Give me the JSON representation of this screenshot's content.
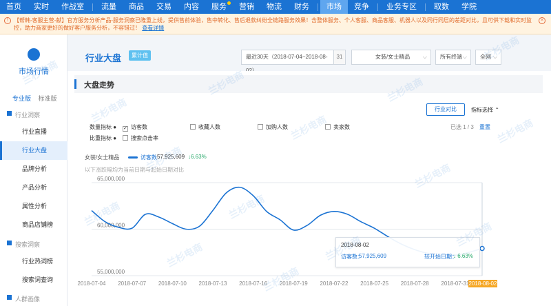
{
  "nav": {
    "items": [
      "首页",
      "实时",
      "作战室",
      "流量",
      "商品",
      "交易",
      "内容",
      "服务",
      "营销",
      "物流",
      "财务",
      "市场",
      "竞争",
      "业务专区",
      "取数",
      "学院"
    ],
    "active": "市场"
  },
  "notice": {
    "text": "【帮韩-客服主营-献】官方服务分析产品-服务洞察已隆重上线，提供售前体验，售中转化、售后退款纠纷全链路服务效果！含整体服务、个人客服、商品客服、机器人以及同行同层的差距对比，且可供下载和实时监控，助力商家更好的做好客户服务分析，不容错过！",
    "link": "查看详情",
    "warn_icon": "!",
    "close_icon": "×"
  },
  "sidebar": {
    "title": "市场行情",
    "tabs": [
      "专业版",
      "标准版"
    ],
    "groups": [
      {
        "label": "行业洞察",
        "items": [
          "行业直播",
          "行业大盘",
          "品牌分析",
          "产品分析",
          "属性分析",
          "商品店铺榜"
        ]
      },
      {
        "label": "搜索洞察",
        "items": [
          "行业热词榜",
          "搜索词查询"
        ]
      },
      {
        "label": "人群画像",
        "items": []
      }
    ],
    "active": "行业大盘"
  },
  "header": {
    "title": "行业大盘",
    "badge": "累计值",
    "date_range": "最近30天（2018-07-04~2018-08-02）",
    "calendar_icon": "31",
    "category": "女装/女士精品",
    "terminal": "所有终端",
    "scope": "全网"
  },
  "panel": {
    "title": "大盘走势",
    "compare_button": "行业对比",
    "metric_select": "指标选择",
    "metric_label": "数量指标",
    "compare_label": "比重指标",
    "checkboxes": [
      {
        "label": "访客数",
        "checked": true
      },
      {
        "label": "收藏人数",
        "checked": false
      },
      {
        "label": "加购人数",
        "checked": false
      },
      {
        "label": "卖家数",
        "checked": false
      },
      {
        "label": "搜索点击率",
        "checked": false
      }
    ],
    "checked_mark": "✓",
    "pager": "已选 1 / 3",
    "reset": "重置",
    "legend_category": "女装/女士精品",
    "legend_series": "访客数",
    "legend_value": "57,925,609",
    "legend_change": "↓6.63%",
    "subnote": "以下涨跌幅均为当前日期与起始日期对比"
  },
  "tooltip": {
    "date": "2018-08-02",
    "name": "访客数：",
    "value": "57,925,609",
    "compare": "较开始日期：",
    "change": "↓ 6.63%"
  },
  "watermark": "兰杉电商",
  "chart_data": {
    "type": "line",
    "x": [
      "2018-07-04",
      "2018-07-05",
      "2018-07-06",
      "2018-07-07",
      "2018-07-08",
      "2018-07-09",
      "2018-07-10",
      "2018-07-11",
      "2018-07-12",
      "2018-07-13",
      "2018-07-14",
      "2018-07-15",
      "2018-07-16",
      "2018-07-17",
      "2018-07-18",
      "2018-07-19",
      "2018-07-20",
      "2018-07-21",
      "2018-07-22",
      "2018-07-23",
      "2018-07-24",
      "2018-07-25",
      "2018-07-26",
      "2018-07-27",
      "2018-07-28",
      "2018-07-29",
      "2018-07-30",
      "2018-07-31",
      "2018-08-01",
      "2018-08-02"
    ],
    "tick_labels": [
      "2018-07-04",
      "2018-07-07",
      "2018-07-10",
      "2018-07-13",
      "2018-07-16",
      "2018-07-19",
      "2018-07-22",
      "2018-07-25",
      "2018-07-28",
      "2018-07-31"
    ],
    "highlight_label": "2018-08-02",
    "series": [
      {
        "name": "访客数",
        "color": "#1b73d3",
        "values": [
          62000000,
          60800000,
          60200000,
          60100000,
          61600000,
          61300000,
          60600000,
          60000000,
          60300000,
          62000000,
          63900000,
          64500000,
          63600000,
          61900000,
          61000000,
          59900000,
          60400000,
          61500000,
          61900000,
          61600000,
          60800000,
          60100000,
          59200000,
          58400000,
          57800000,
          57400000,
          57300000,
          57200000,
          57500000,
          57925609
        ]
      }
    ],
    "ylim": [
      55000000,
      65000000
    ],
    "y_ticks": [
      "55,000,000",
      "60,000,000",
      "65,000,000"
    ],
    "grid": true
  }
}
